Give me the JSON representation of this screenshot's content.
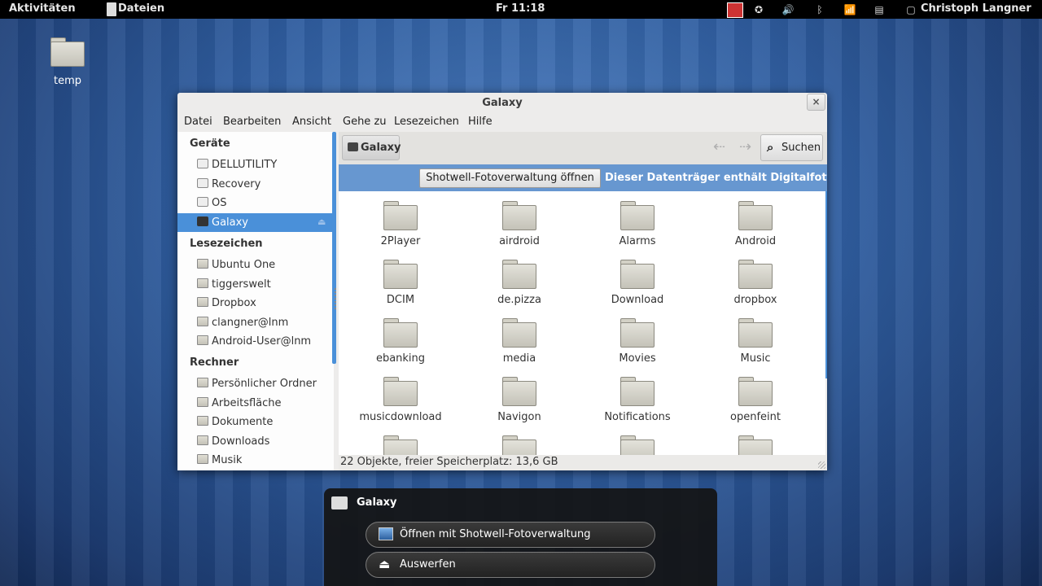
{
  "top_panel": {
    "activities": "Aktivitäten",
    "app_name": "Dateien",
    "clock": "Fr 11:18",
    "user": "Christoph Langner"
  },
  "desktop": {
    "icon_label": "temp"
  },
  "window": {
    "title": "Galaxy",
    "close_glyph": "×",
    "menu": [
      "Datei",
      "Bearbeiten",
      "Ansicht",
      "Gehe zu",
      "Lesezeichen",
      "Hilfe"
    ],
    "sidebar": {
      "devices_heading": "Geräte",
      "devices": [
        "DELLUTILITY",
        "Recovery",
        "OS",
        "Galaxy"
      ],
      "bookmarks_heading": "Lesezeichen",
      "bookmarks": [
        "Ubuntu One",
        "tiggerswelt",
        "Dropbox",
        "clangner@lnm",
        "Android-User@lnm"
      ],
      "computer_heading": "Rechner",
      "computer": [
        "Persönlicher Ordner",
        "Arbeitsfläche",
        "Dokumente",
        "Downloads",
        "Musik"
      ]
    },
    "toolbar": {
      "path": "Galaxy",
      "search": "Suchen"
    },
    "infobar": {
      "button": "Shotwell-Fotoverwaltung öffnen",
      "message": "Dieser Datenträger enthält Digitalfotos."
    },
    "files": [
      "2Player",
      "airdroid",
      "Alarms",
      "Android",
      "DCIM",
      "de.pizza",
      "Download",
      "dropbox",
      "ebanking",
      "media",
      "Movies",
      "Music",
      "musicdownload",
      "Navigon",
      "Notifications",
      "openfeint"
    ],
    "status": "22 Objekte, freier Speicherplatz: 13,6 GB"
  },
  "notification": {
    "title": "Galaxy",
    "open_button": "Öffnen mit Shotwell-Fotoverwaltung",
    "eject_button": "Auswerfen"
  },
  "colors": {
    "selection": "#4a90d9",
    "infobar": "#6797d0"
  }
}
